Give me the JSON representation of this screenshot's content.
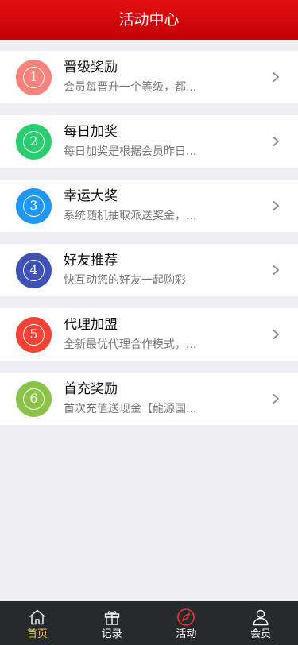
{
  "header": {
    "title": "活动中心"
  },
  "items": [
    {
      "num": "1",
      "color": "#f8837d",
      "title": "晋级奖励",
      "desc": "会员每晋升一个等级，都..."
    },
    {
      "num": "2",
      "color": "#2ecc71",
      "title": "每日加奖",
      "desc": "每日加奖是根据会员昨日..."
    },
    {
      "num": "3",
      "color": "#2196f3",
      "title": "幸运大奖",
      "desc": "系统随机抽取派送奖金，..."
    },
    {
      "num": "4",
      "color": "#3f51b5",
      "title": "好友推荐",
      "desc": "快互动您的好友一起购彩"
    },
    {
      "num": "5",
      "color": "#f44336",
      "title": "代理加盟",
      "desc": "全新最优代理合作模式，..."
    },
    {
      "num": "6",
      "color": "#8bc34a",
      "title": "首充奖励",
      "desc": "首次充值送现金【龍源国..."
    }
  ],
  "tabbar": {
    "tabs": [
      {
        "label": "首页",
        "icon": "home-icon",
        "color": "#f5c542"
      },
      {
        "label": "记录",
        "icon": "gift-icon",
        "color": "#ffffff"
      },
      {
        "label": "活动",
        "icon": "compass-icon",
        "color": "#ffffff"
      },
      {
        "label": "会员",
        "icon": "user-icon",
        "color": "#ffffff"
      }
    ]
  }
}
